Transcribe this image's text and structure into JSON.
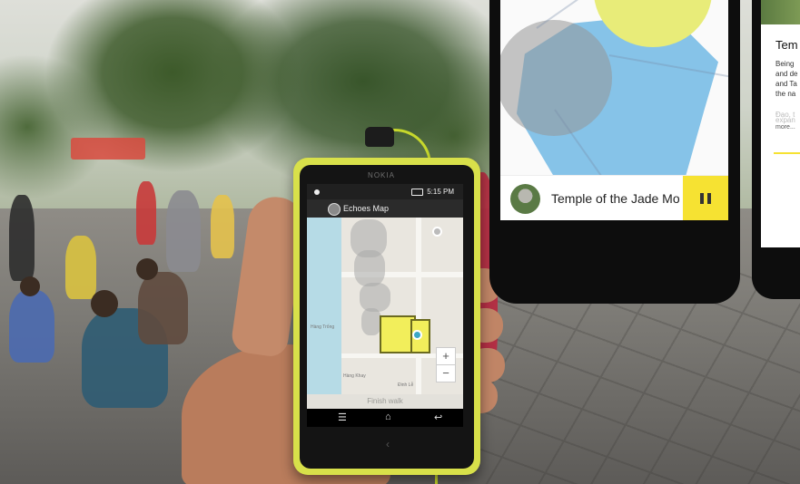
{
  "held_phone": {
    "brand": "NOKIA",
    "status_time": "5:15 PM",
    "app_title": "Echoes Map",
    "finish_label": "Finish walk",
    "zoom_in": "+",
    "zoom_out": "−",
    "nav_menu_glyph": "☰",
    "nav_home_glyph": "⌂",
    "nav_back_glyph": "↩",
    "hw_back_glyph": "‹",
    "map_labels": [
      "Hàng Trống",
      "Hàng Khay",
      "Đinh Lễ"
    ]
  },
  "preview_phone": {
    "track_title": "Temple of the Jade Mo",
    "state": "playing",
    "accent_color": "#f6e232"
  },
  "detail_phone": {
    "title": "Tem",
    "body_lines": [
      "Being",
      "and de",
      "and Ta",
      "the na"
    ],
    "faded_lines": [
      "Đạo, t",
      "expan"
    ],
    "more_label": "more..."
  }
}
